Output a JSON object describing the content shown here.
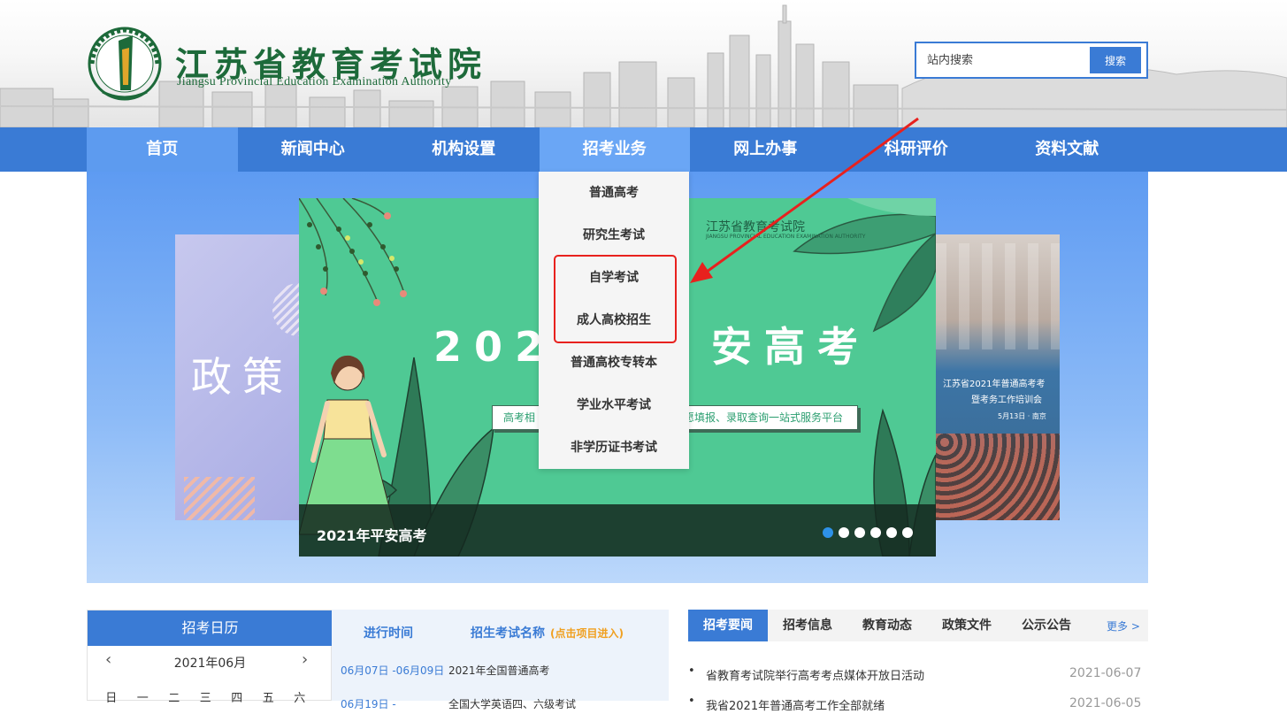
{
  "header": {
    "logo_cn": "江苏省教育考试院",
    "logo_en": "Jiangsu Provincial Education Examination Authority",
    "search_placeholder": "站内搜索",
    "search_button": "搜索"
  },
  "nav": {
    "items": [
      "首页",
      "新闻中心",
      "机构设置",
      "招考业务",
      "网上办事",
      "科研评价",
      "资料文献"
    ]
  },
  "dropdown": {
    "items": [
      "普通高考",
      "研究生考试",
      "自学考试",
      "成人高校招生",
      "普通高校专转本",
      "学业水平考试",
      "非学历证书考试"
    ]
  },
  "banner": {
    "left_side_text": "政策",
    "right_side_text1": "江苏省2021年普通高考考",
    "right_side_text2": "暨考务工作培训会",
    "right_side_text3": "5月13日 · 南京",
    "slide_logo": "江苏省教育考试院",
    "slide_logo_sub": "JIANGSU PROVINCIAL EDUCATION EXAMINATION AUTHORITY",
    "slide_title_left": "202",
    "slide_title_right": "安高考",
    "slide_subtitle_left": "高考相",
    "slide_subtitle_right": "愿填报、录取查询一站式服务平台",
    "slide_caption": "2021年平安高考",
    "dots_count": 6,
    "active_dot": 0
  },
  "calendar": {
    "title": "招考日历",
    "month": "2021年06月",
    "prev": "‹",
    "next": "›",
    "weekdays": [
      "日",
      "一",
      "二",
      "三",
      "四",
      "五",
      "六"
    ]
  },
  "schedule": {
    "col_time": "进行时间",
    "col_name": "招生考试名称",
    "col_hint": "(点击项目进入)",
    "rows": [
      {
        "date": "06月07日 -06月09日",
        "name": "2021年全国普通高考"
      },
      {
        "date": "06月19日 -",
        "name": "全国大学英语四、六级考试"
      }
    ]
  },
  "news": {
    "tabs": [
      "招考要闻",
      "招考信息",
      "教育动态",
      "政策文件",
      "公示公告"
    ],
    "more": "更多 >",
    "items": [
      {
        "title": "省教育考试院举行高考考点媒体开放日活动",
        "date": "2021-06-07"
      },
      {
        "title": "我省2021年普通高考工作全部就绪",
        "date": "2021-06-05"
      }
    ]
  },
  "colors": {
    "primary": "#3a7bd5",
    "logo_green": "#1d6a3a",
    "slide_green": "#4fc994",
    "highlight_red": "#e8211e"
  }
}
